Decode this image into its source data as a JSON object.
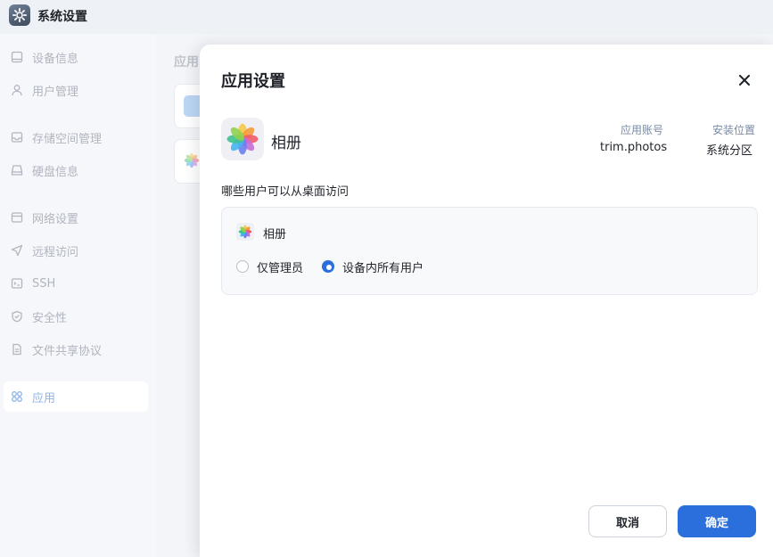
{
  "window": {
    "title": "系统设置",
    "icon": "gear-icon"
  },
  "sidebar": {
    "items": [
      {
        "label": "设备信息",
        "icon": "monitor-icon"
      },
      {
        "label": "用户管理",
        "icon": "user-icon"
      },
      {
        "label": "存储空间管理",
        "icon": "storage-icon"
      },
      {
        "label": "硬盘信息",
        "icon": "disk-icon"
      },
      {
        "label": "网络设置",
        "icon": "network-icon"
      },
      {
        "label": "远程访问",
        "icon": "send-icon"
      },
      {
        "label": "SSH",
        "icon": "terminal-icon"
      },
      {
        "label": "安全性",
        "icon": "shield-icon"
      },
      {
        "label": "文件共享协议",
        "icon": "file-icon"
      },
      {
        "label": "应用",
        "icon": "apps-icon",
        "active": true
      }
    ]
  },
  "main": {
    "heading": "应用"
  },
  "modal": {
    "title": "应用设置",
    "app": {
      "name": "相册",
      "account_label": "应用账号",
      "account_value": "trim.photos",
      "location_label": "安装位置",
      "location_value": "系统分区"
    },
    "section_label": "哪些用户可以从桌面访问",
    "permission": {
      "app_name": "相册",
      "options": [
        {
          "label": "仅管理员",
          "checked": false
        },
        {
          "label": "设备内所有用户",
          "checked": true
        }
      ]
    },
    "cancel_label": "取消",
    "ok_label": "确定"
  },
  "colors": {
    "accent": "#2a6fdb",
    "sidebar_active_text": "#8fb4e6"
  }
}
